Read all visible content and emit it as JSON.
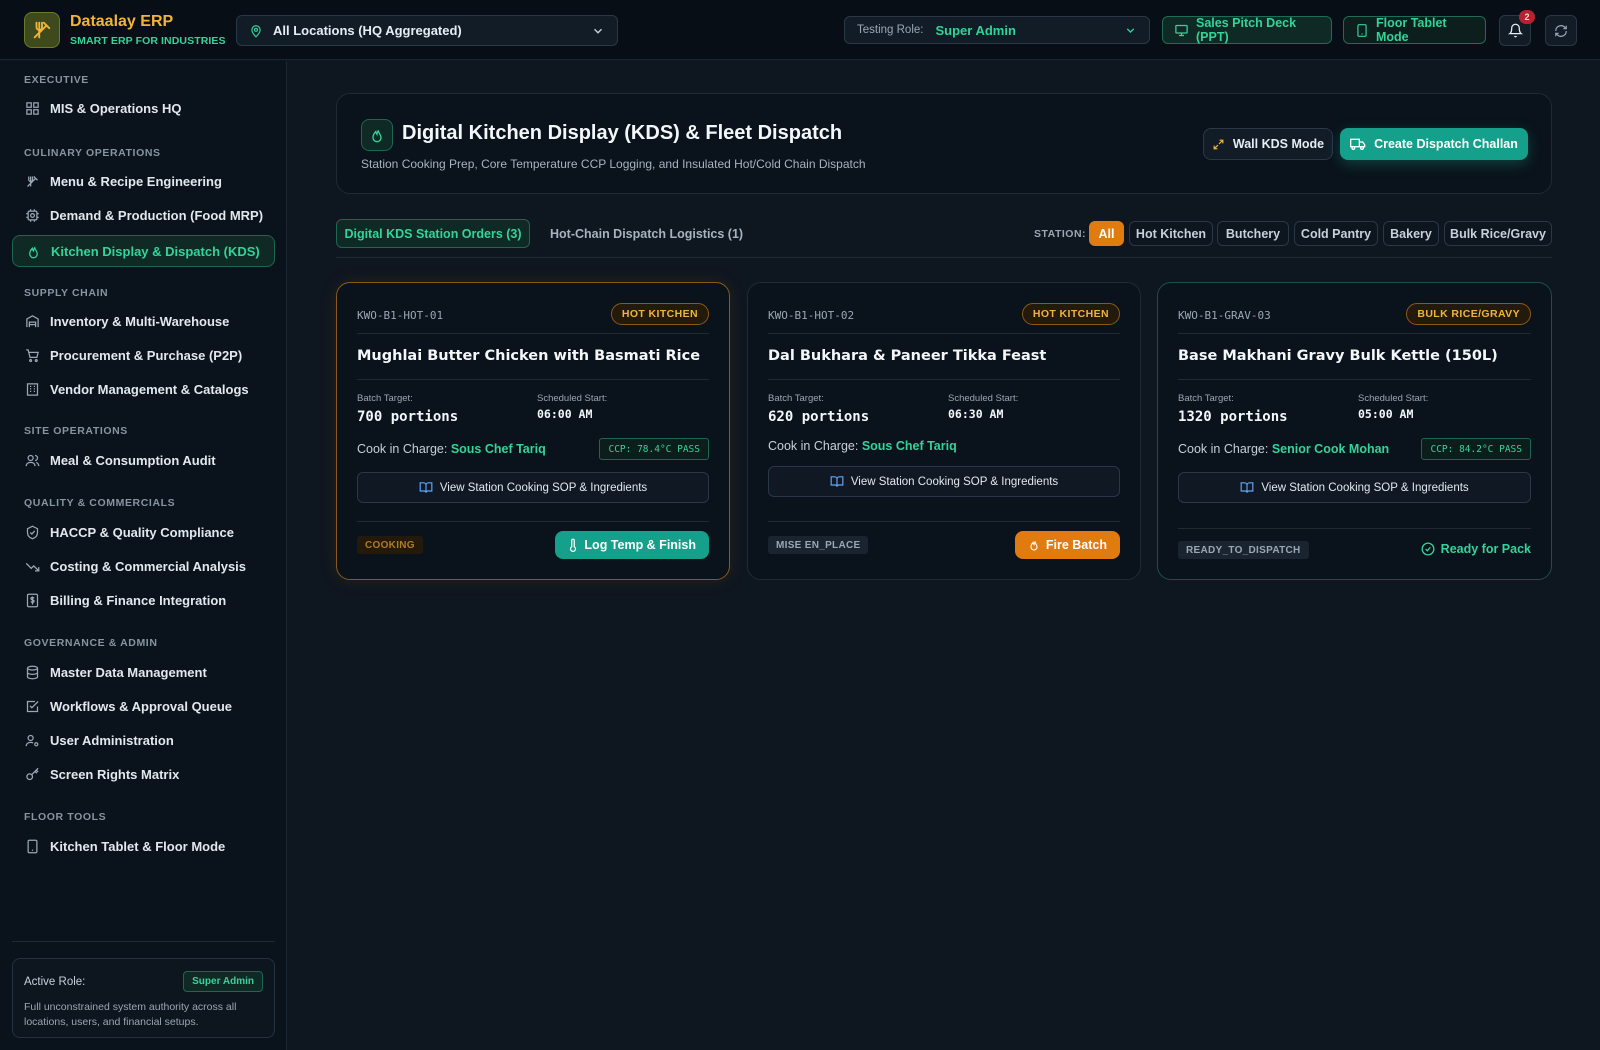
{
  "brand": {
    "title": "Dataalay ERP",
    "subtitle": "SMART ERP FOR INDUSTRIES"
  },
  "topbar": {
    "location": "All Locations (HQ Aggregated)",
    "role_label": "Testing Role:",
    "role_value": "Super Admin",
    "pitch_button": "Sales Pitch Deck (PPT)",
    "floor_button": "Floor Tablet Mode",
    "notification_count": "2"
  },
  "sidebar": {
    "sections": [
      {
        "title": "EXECUTIVE",
        "items": [
          {
            "label": "MIS & Operations HQ",
            "icon": "grid-icon"
          }
        ]
      },
      {
        "title": "CULINARY OPERATIONS",
        "items": [
          {
            "label": "Menu & Recipe Engineering",
            "icon": "utensils-icon"
          },
          {
            "label": "Demand & Production (Food MRP)",
            "icon": "cpu-icon"
          },
          {
            "label": "Kitchen Display & Dispatch (KDS)",
            "icon": "flame-icon",
            "active": true
          }
        ]
      },
      {
        "title": "SUPPLY CHAIN",
        "items": [
          {
            "label": "Inventory & Multi-Warehouse",
            "icon": "warehouse-icon"
          },
          {
            "label": "Procurement & Purchase (P2P)",
            "icon": "cart-icon"
          },
          {
            "label": "Vendor Management & Catalogs",
            "icon": "building-icon"
          }
        ]
      },
      {
        "title": "SITE OPERATIONS",
        "items": [
          {
            "label": "Meal & Consumption Audit",
            "icon": "users-icon"
          }
        ]
      },
      {
        "title": "QUALITY & COMMERCIALS",
        "items": [
          {
            "label": "HACCP & Quality Compliance",
            "icon": "shield-check-icon"
          },
          {
            "label": "Costing & Commercial Analysis",
            "icon": "trend-down-icon"
          },
          {
            "label": "Billing & Finance Integration",
            "icon": "dollar-icon"
          }
        ]
      },
      {
        "title": "GOVERNANCE & ADMIN",
        "items": [
          {
            "label": "Master Data Management",
            "icon": "database-icon"
          },
          {
            "label": "Workflows & Approval Queue",
            "icon": "check-square-icon"
          },
          {
            "label": "User Administration",
            "icon": "user-gear-icon"
          },
          {
            "label": "Screen Rights Matrix",
            "icon": "key-icon"
          }
        ]
      },
      {
        "title": "FLOOR TOOLS",
        "items": [
          {
            "label": "Kitchen Tablet & Floor Mode",
            "icon": "tablet-icon"
          }
        ]
      }
    ],
    "role_card": {
      "label": "Active Role:",
      "role": "Super Admin",
      "description": "Full unconstrained system authority across all locations, users, and financial setups."
    }
  },
  "header": {
    "title": "Digital Kitchen Display (KDS) & Fleet Dispatch",
    "subtitle": "Station Cooking Prep, Core Temperature CCP Logging, and Insulated Hot/Cold Chain Dispatch",
    "wall_button": "Wall KDS Mode",
    "create_button": "Create Dispatch Challan"
  },
  "tabs": {
    "kds": "Digital KDS Station Orders (3)",
    "dispatch": "Hot-Chain Dispatch Logistics (1)"
  },
  "stations": {
    "label": "STATION:",
    "chips": [
      "All",
      "Hot Kitchen",
      "Butchery",
      "Cold Pantry",
      "Bakery",
      "Bulk Rice/Gravy"
    ],
    "selected": "All"
  },
  "orders": [
    {
      "code": "KWO-B1-HOT-01",
      "station": "HOT KITCHEN",
      "dish": "Mughlai Butter Chicken with Basmati Rice",
      "batch_label": "Batch Target:",
      "batch": "700 portions",
      "start_label": "Scheduled Start:",
      "start": "06:00 AM",
      "cook_label": "Cook in Charge:",
      "cook": "Sous Chef Tariq",
      "ccp": "CCP: 78.4°C PASS",
      "sop": "View Station Cooking SOP & Ingredients",
      "status": "COOKING",
      "action": "Log Temp & Finish"
    },
    {
      "code": "KWO-B1-HOT-02",
      "station": "HOT KITCHEN",
      "dish": "Dal Bukhara & Paneer Tikka Feast",
      "batch_label": "Batch Target:",
      "batch": "620 portions",
      "start_label": "Scheduled Start:",
      "start": "06:30 AM",
      "cook_label": "Cook in Charge:",
      "cook": "Sous Chef Tariq",
      "sop": "View Station Cooking SOP & Ingredients",
      "status": "MISE EN_PLACE",
      "action": "Fire Batch"
    },
    {
      "code": "KWO-B1-GRAV-03",
      "station": "BULK RICE/GRAVY",
      "dish": "Base Makhani Gravy Bulk Kettle (150L)",
      "batch_label": "Batch Target:",
      "batch": "1320 portions",
      "start_label": "Scheduled Start:",
      "start": "05:00 AM",
      "cook_label": "Cook in Charge:",
      "cook": "Senior Cook Mohan",
      "ccp": "CCP: 84.2°C PASS",
      "sop": "View Station Cooking SOP & Ingredients",
      "status": "READY_TO_DISPATCH",
      "action": "Ready for Pack"
    }
  ],
  "colors": {
    "accent": "#34d399",
    "brand": "#f0b43a",
    "primary_button": "#14a08a",
    "warning_button": "#e07b10",
    "background": "#0e1620"
  }
}
